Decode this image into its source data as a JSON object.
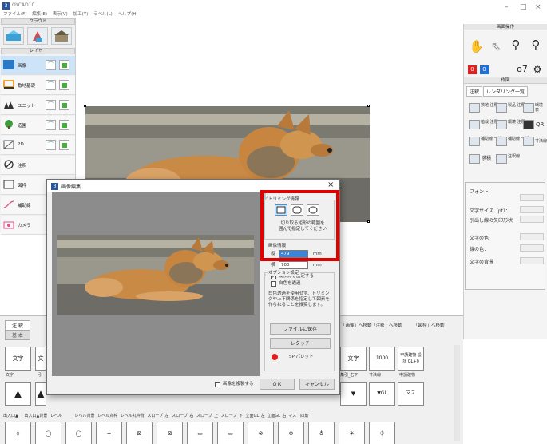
{
  "app": {
    "title": "OYCAD10",
    "menu": [
      "ファイル(F)",
      "編集(E)",
      "表示(V)",
      "加工(Y)",
      "ラベル(L)",
      "ヘルプ(H)"
    ]
  },
  "left_panel": {
    "cloud_header": "クラウド",
    "layer_header": "レイヤー",
    "layers": [
      {
        "label": "画像",
        "selected": true
      },
      {
        "label": "敷地基礎",
        "selected": false
      },
      {
        "label": "ユニット",
        "selected": false
      },
      {
        "label": "造園",
        "selected": false
      },
      {
        "label": "2D",
        "selected": false
      },
      {
        "label": "注釈",
        "selected": false
      },
      {
        "label": "図枠",
        "selected": false
      },
      {
        "label": "補助線",
        "selected": false
      },
      {
        "label": "カメラ",
        "selected": false
      }
    ]
  },
  "right_panel": {
    "screen_ops_header": "画面操作",
    "num1": "0",
    "num2": "0",
    "drawing_header": "作図",
    "tabs": [
      "注釈",
      "レンダリング一覧"
    ],
    "items": [
      {
        "label": "数地\n注釈"
      },
      {
        "label": "製品\n注釈"
      },
      {
        "label": "環境\n表"
      },
      {
        "label": "植栽\n注釈"
      },
      {
        "label": "環境\n注釈"
      },
      {
        "label": "QR"
      },
      {
        "label": "補助線\n一括"
      },
      {
        "label": "補助線\n一括"
      },
      {
        "label": "寸法線"
      },
      {
        "label": "求積"
      },
      {
        "label": "注釈線"
      }
    ],
    "props": {
      "font_label": "フォント：",
      "text_size_label": "文字サイズ（pt）：",
      "arrow_label": "引出し線の矢印形状",
      "text_color_label": "文字の色：",
      "line_color_label": "線の色：",
      "bg_label": "文字の背景"
    }
  },
  "bottom_panel": {
    "tab_active": "注 釈",
    "tab_sub": "基 本",
    "nav_buttons": [
      "「画像」へ移動",
      "「注釈」へ移動",
      "「図枠」へ移動"
    ],
    "row1_cells": [
      "文字",
      "文",
      "",
      "",
      "",
      "",
      "",
      "",
      "",
      "",
      "文字",
      "1000",
      "申請建物\n設計 GL+0"
    ],
    "row1_labels": [
      "文字",
      "引",
      "",
      "",
      "",
      "",
      "",
      "",
      "",
      "",
      "角引_右下",
      "寸法線",
      "申請建物"
    ],
    "row2_labels": [
      "出入口▲",
      "出入口▲背景",
      "レベル",
      "レベル背景",
      "レベル丸枠",
      "レベル丸枠背",
      "スロープ_左",
      "スロープ_右",
      "スロープ_上",
      "スロープ_下",
      "立面GL_左",
      "立面GL_右",
      "マス__四角"
    ]
  },
  "dialog": {
    "title": "画像編集",
    "close": "×",
    "trim_group": "トリミング情報",
    "trim_help": "切り取る矩形の範囲を\n囲んで指定してください",
    "size_group": "画像情報",
    "height_label": "縦",
    "height_value": "479",
    "width_label": "横",
    "width_value": "700",
    "unit": "mm",
    "lock_label": "縦横比を固定する",
    "lock_checked": true,
    "option_group": "オプション設定",
    "whiteout_label": "白色を透過",
    "whiteout_checked": false,
    "option_help": "白色透過を使用せず、トリミングや上下関係を指定して図素を作られることを推奨します。",
    "save_button": "ファイルに保存",
    "retouch_button": "レタッチ",
    "palette_label": "SP パレット",
    "duplicate_label": "画像を複製する",
    "ok_button": "ＯＫ",
    "cancel_button": "キャンセル"
  },
  "colors": {
    "highlight": "#e00000",
    "accent": "#3b84d6",
    "num1": "#e02020",
    "num2": "#1e6fd9"
  }
}
